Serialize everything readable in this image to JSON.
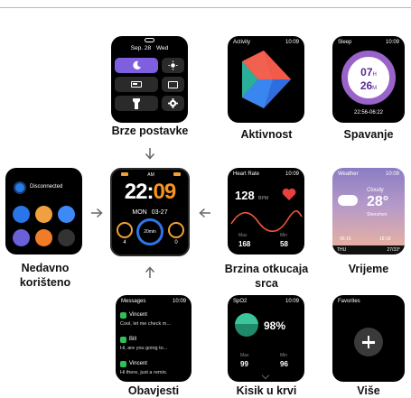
{
  "quick_settings": {
    "label": "Brze postavke",
    "date": "Sep. 28",
    "weekday": "Wed"
  },
  "activity": {
    "label": "Aktivnost",
    "screen_title": "Activity",
    "time": "10:09"
  },
  "sleep": {
    "label": "Spavanje",
    "screen_title": "Sleep",
    "time": "10:09",
    "hours": "07",
    "hours_unit": "H",
    "minutes": "26",
    "minutes_unit": "M",
    "range": "22:56-06:22"
  },
  "recent": {
    "label_line1": "Nedavno",
    "label_line2": "korišteno",
    "status": "Disconnected"
  },
  "watchface": {
    "time_h": "22",
    "time_sep": ":",
    "time_m": "09",
    "am_pm": "AM",
    "weekday": "MON",
    "date": "03-27",
    "center_value": "20min",
    "left_value": "4",
    "right_value": "0"
  },
  "heart_rate": {
    "label_line1": "Brzina otkucaja",
    "label_line2": "srca",
    "screen_title": "Heart Rate",
    "time": "10:09",
    "value": "128",
    "unit": "BPM",
    "max_label": "Max",
    "max_value": "168",
    "min_label": "Min",
    "min_value": "58"
  },
  "weather": {
    "label": "Vrijeme",
    "screen_title": "Weather",
    "time": "10:09",
    "condition": "Cloudy",
    "temp": "28°",
    "city": "Shenzhen",
    "sunrise": "06:15",
    "sunset": "18:18",
    "day": "THU",
    "range": "27/33°"
  },
  "messages": {
    "label": "Obavjesti",
    "screen_title": "Messages",
    "time": "10:09",
    "items": [
      {
        "name": "Vincent",
        "text": "Cool, let me check m..."
      },
      {
        "name": "Bill",
        "text": "Hi, are you going to..."
      },
      {
        "name": "Vincent",
        "text": "Hi there, just a remin."
      }
    ]
  },
  "spo2": {
    "label": "Kisik u krvi",
    "screen_title": "SpO2",
    "time": "10:09",
    "value": "98%",
    "max_label": "Max",
    "max_value": "99",
    "min_label": "Min",
    "min_value": "96"
  },
  "favorites": {
    "label": "Više",
    "screen_title": "Favorites"
  }
}
